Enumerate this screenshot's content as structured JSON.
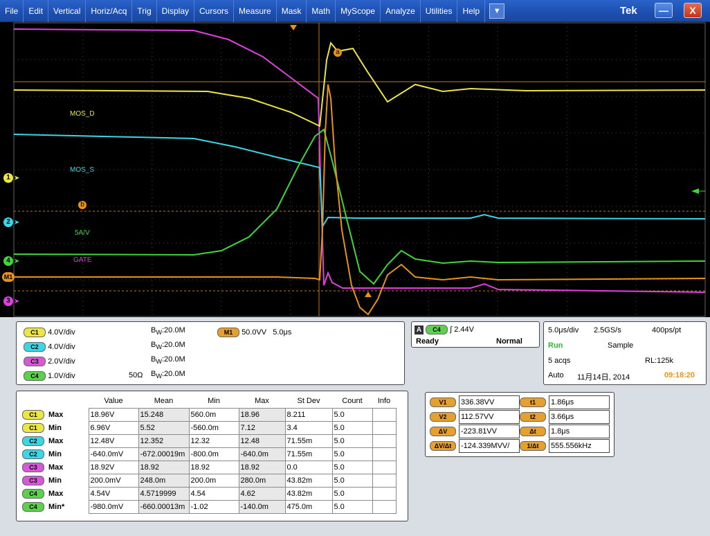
{
  "menu": {
    "items": [
      "File",
      "Edit",
      "Vertical",
      "Horiz/Acq",
      "Trig",
      "Display",
      "Cursors",
      "Measure",
      "Mask",
      "Math",
      "MyScope",
      "Analyze",
      "Utilities",
      "Help"
    ],
    "brand": "Tek",
    "minimize": "—",
    "close": "X"
  },
  "waveform": {
    "labels": {
      "mos_d": "MOS_D",
      "mos_s": "MOS_S",
      "scale": "5A/V",
      "gate": "GATE",
      "cursor_a": "a",
      "cursor_b": "b"
    },
    "markers": {
      "c1": "1",
      "c2": "2",
      "c4": "4",
      "m1": "M1",
      "c3": "3"
    },
    "colors": {
      "c1": "#ece645",
      "c2": "#3bd7e6",
      "c3": "#e040e0",
      "c4": "#3fd63a",
      "m1": "#e8921a"
    }
  },
  "channels": [
    {
      "badge": "C1",
      "scale": "4.0V/div",
      "bw_prefix": "B",
      "bw_sub": "W",
      "bw": ":20.0M",
      "impedance": ""
    },
    {
      "badge": "C2",
      "scale": "4.0V/div",
      "bw_prefix": "B",
      "bw_sub": "W",
      "bw": ":20.0M",
      "impedance": ""
    },
    {
      "badge": "C3",
      "scale": "2.0V/div",
      "bw_prefix": "B",
      "bw_sub": "W",
      "bw": ":20.0M",
      "impedance": ""
    },
    {
      "badge": "C4",
      "scale": "1.0V/div",
      "bw_prefix": "B",
      "bw_sub": "W",
      "bw": ":20.0M",
      "impedance": "50Ω"
    }
  ],
  "math": {
    "badge": "M1",
    "scale": "50.0VV",
    "time": "5.0μs"
  },
  "trigger": {
    "mode_badge": "A",
    "source_badge": "C4",
    "slope": "∫",
    "level": "2.44V",
    "state": "Ready",
    "mode": "Normal"
  },
  "acquisition": {
    "time_div": "5.0μs/div",
    "sample_rate": "2.5GS/s",
    "resolution": "400ps/pt",
    "run_state": "Run",
    "mode": "Sample",
    "acqs": "5 acqs",
    "record_length": "RL:125k",
    "trigger_mode": "Auto",
    "date": "11月14日, 2014",
    "time": "09:18:20"
  },
  "measurements": {
    "headers": [
      "Value",
      "Mean",
      "Min",
      "Max",
      "St Dev",
      "Count",
      "Info"
    ],
    "rows": [
      {
        "badge": "C1",
        "type": "Max",
        "cells": [
          "18.96V",
          "15.248",
          "560.0m",
          "18.96",
          "8.211",
          "5.0",
          ""
        ]
      },
      {
        "badge": "C1",
        "type": "Min",
        "cells": [
          "6.96V",
          "5.52",
          "-560.0m",
          "7.12",
          "3.4",
          "5.0",
          ""
        ]
      },
      {
        "badge": "C2",
        "type": "Max",
        "cells": [
          "12.48V",
          "12.352",
          "12.32",
          "12.48",
          "71.55m",
          "5.0",
          ""
        ]
      },
      {
        "badge": "C2",
        "type": "Min",
        "cells": [
          "-640.0mV",
          "-672.00019m",
          "-800.0m",
          "-640.0m",
          "71.55m",
          "5.0",
          ""
        ]
      },
      {
        "badge": "C3",
        "type": "Max",
        "cells": [
          "18.92V",
          "18.92",
          "18.92",
          "18.92",
          "0.0",
          "5.0",
          ""
        ]
      },
      {
        "badge": "C3",
        "type": "Min",
        "cells": [
          "200.0mV",
          "248.0m",
          "200.0m",
          "280.0m",
          "43.82m",
          "5.0",
          ""
        ]
      },
      {
        "badge": "C4",
        "type": "Max",
        "cells": [
          "4.54V",
          "4.5719999",
          "4.54",
          "4.62",
          "43.82m",
          "5.0",
          ""
        ]
      },
      {
        "badge": "C4",
        "type": "Min*",
        "cells": [
          "-980.0mV",
          "-660.00013m",
          "-1.02",
          "-140.0m",
          "475.0m",
          "5.0",
          ""
        ]
      }
    ]
  },
  "cursors": {
    "left": [
      {
        "label": "V1",
        "value": "336.38VV"
      },
      {
        "label": "V2",
        "value": "112.57VV"
      },
      {
        "label": "ΔV",
        "value": "-223.81VV"
      },
      {
        "label": "ΔV/Δt",
        "value": "-124.339MVV/"
      }
    ],
    "right": [
      {
        "label": "t1",
        "value": "1.86μs"
      },
      {
        "label": "t2",
        "value": "3.66μs"
      },
      {
        "label": "Δt",
        "value": "1.8μs"
      },
      {
        "label": "1/Δt",
        "value": "555.556kHz"
      }
    ]
  }
}
